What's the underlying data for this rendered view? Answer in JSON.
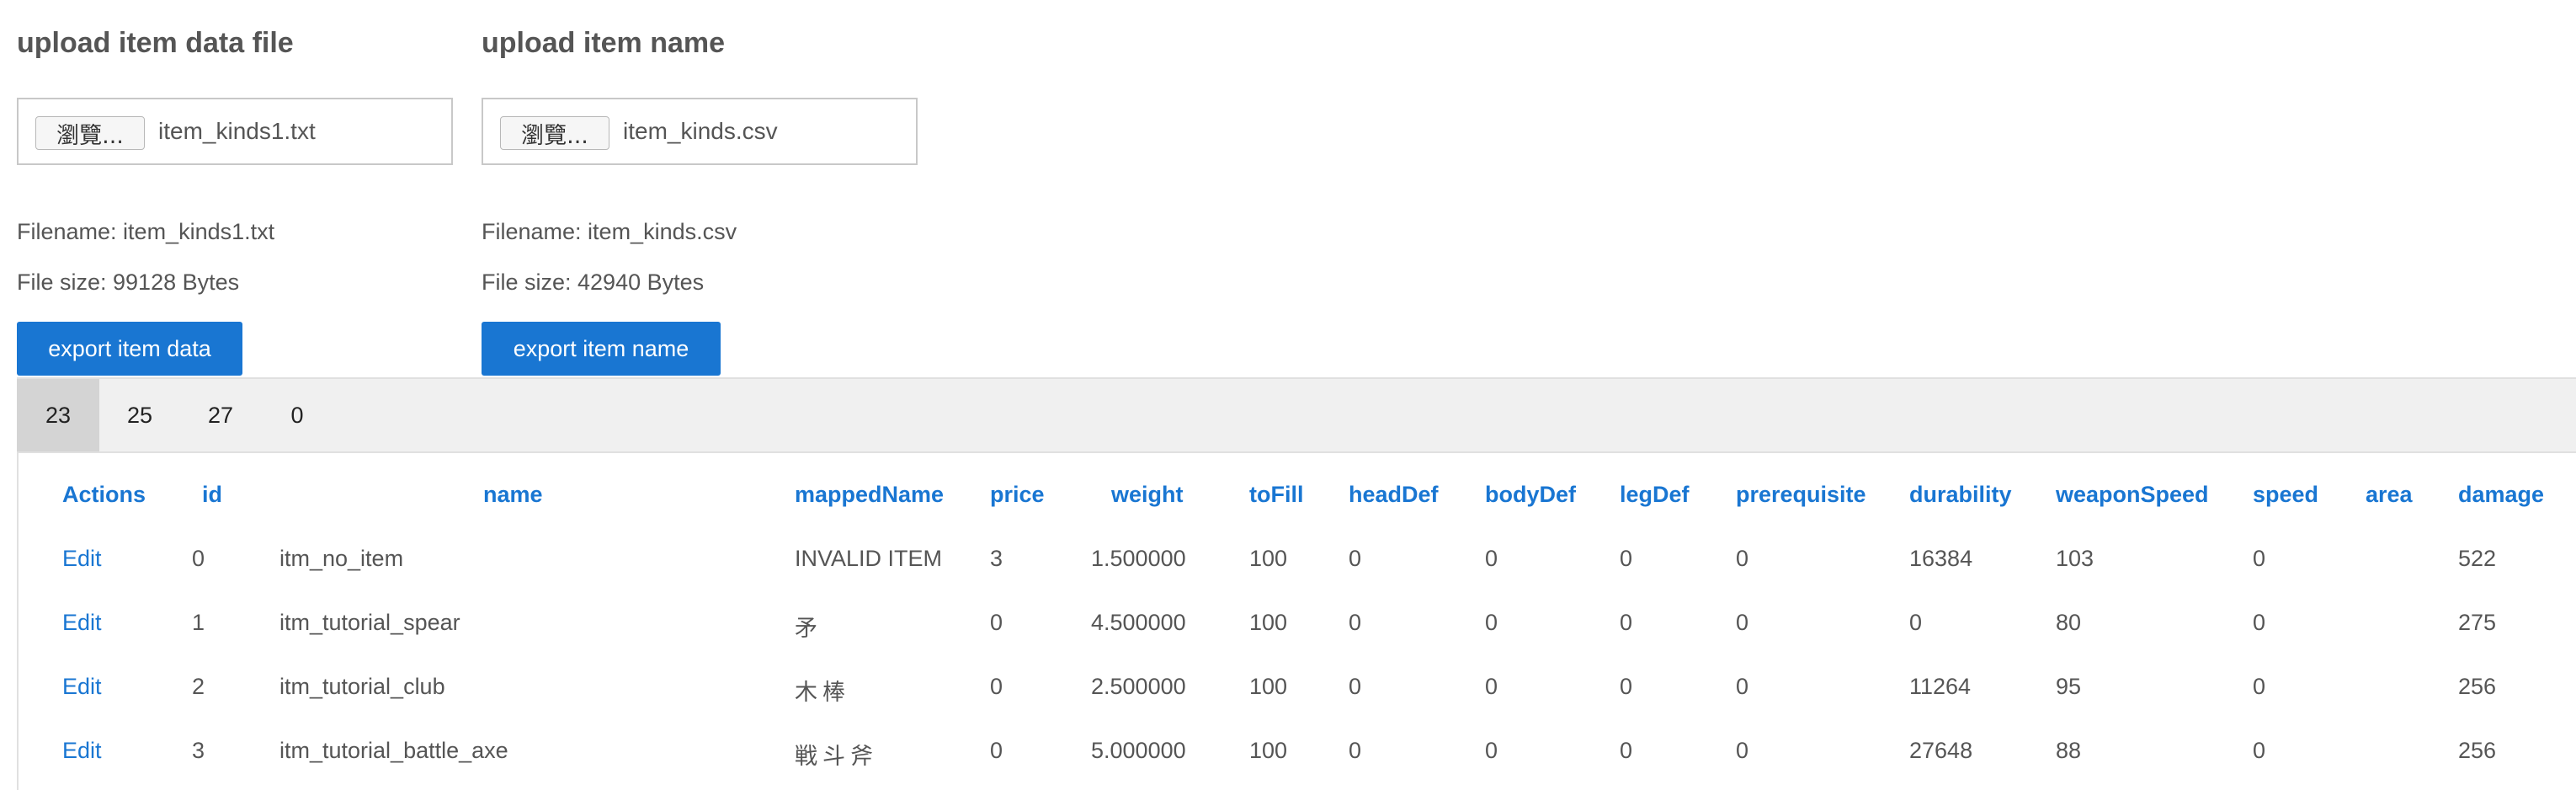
{
  "upload_data": {
    "title": "upload item data file",
    "browse_label": "瀏覽...",
    "chosen_file": "item_kinds1.txt",
    "filename_text": "Filename: item_kinds1.txt",
    "filesize_text": "File size: 99128 Bytes",
    "export_label": "export item data"
  },
  "upload_name": {
    "title": "upload item name",
    "browse_label": "瀏覽...",
    "chosen_file": "item_kinds.csv",
    "filename_text": "Filename: item_kinds.csv",
    "filesize_text": "File size: 42940 Bytes",
    "export_label": "export item name"
  },
  "tabs": [
    {
      "label": "23",
      "active": true
    },
    {
      "label": "25",
      "active": false
    },
    {
      "label": "27",
      "active": false
    },
    {
      "label": "0",
      "active": false
    }
  ],
  "table": {
    "headers": [
      "Actions",
      "id",
      "name",
      "mappedName",
      "price",
      "weight",
      "toFill",
      "headDef",
      "bodyDef",
      "legDef",
      "prerequisite",
      "durability",
      "weaponSpeed",
      "speed",
      "area",
      "damage"
    ],
    "rows": [
      {
        "action": "Edit",
        "id": "0",
        "name": "itm_no_item",
        "mappedName": "INVALID ITEM",
        "price": "3",
        "weight": "1.500000",
        "toFill": "100",
        "headDef": "0",
        "bodyDef": "0",
        "legDef": "0",
        "prerequisite": "0",
        "durability": "16384",
        "weaponSpeed": "103",
        "speed": "0",
        "area": "",
        "damage": "522"
      },
      {
        "action": "Edit",
        "id": "1",
        "name": "itm_tutorial_spear",
        "mappedName": "矛",
        "price": "0",
        "weight": "4.500000",
        "toFill": "100",
        "headDef": "0",
        "bodyDef": "0",
        "legDef": "0",
        "prerequisite": "0",
        "durability": "0",
        "weaponSpeed": "80",
        "speed": "0",
        "area": "",
        "damage": "275"
      },
      {
        "action": "Edit",
        "id": "2",
        "name": "itm_tutorial_club",
        "mappedName": "木棒",
        "price": "0",
        "weight": "2.500000",
        "toFill": "100",
        "headDef": "0",
        "bodyDef": "0",
        "legDef": "0",
        "prerequisite": "0",
        "durability": "11264",
        "weaponSpeed": "95",
        "speed": "0",
        "area": "",
        "damage": "256"
      },
      {
        "action": "Edit",
        "id": "3",
        "name": "itm_tutorial_battle_axe",
        "mappedName": "戦斗斧",
        "price": "0",
        "weight": "5.000000",
        "toFill": "100",
        "headDef": "0",
        "bodyDef": "0",
        "legDef": "0",
        "prerequisite": "0",
        "durability": "27648",
        "weaponSpeed": "88",
        "speed": "0",
        "area": "",
        "damage": "256"
      }
    ]
  },
  "colors": {
    "accent": "#1976d2",
    "text": "#555555",
    "tab_strip": "#f0f0f0",
    "tab_active": "#d4d4d4"
  }
}
